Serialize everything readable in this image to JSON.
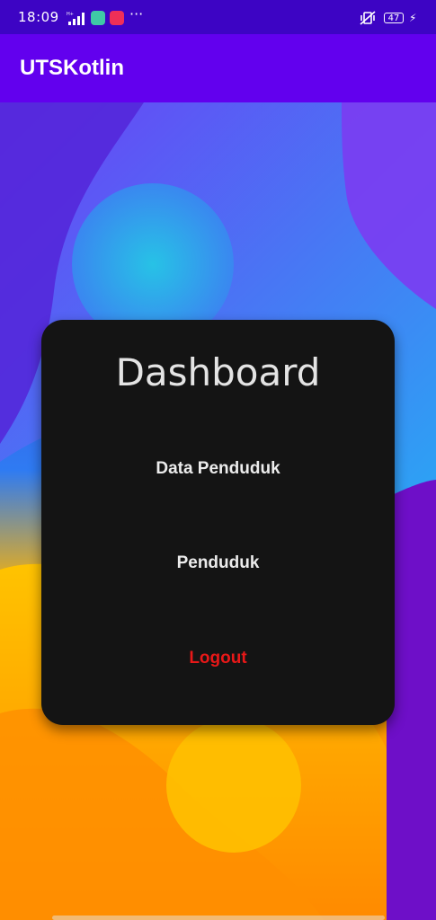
{
  "status_bar": {
    "time": "18:09",
    "battery": "47",
    "more": "···",
    "icons": [
      "signal-icon",
      "app-notification-icon",
      "video-record-icon",
      "vibrate-icon",
      "battery-icon",
      "charging-icon"
    ]
  },
  "app_bar": {
    "title": "UTSKotlin"
  },
  "dashboard": {
    "title": "Dashboard",
    "buttons": {
      "data_penduduk": "Data Penduduk",
      "penduduk": "Penduduk",
      "logout": "Logout"
    }
  },
  "colors": {
    "status_bar": "#3d04c4",
    "app_bar": "#6200ee",
    "card_bg": "#141414",
    "logout_text": "#e81818"
  }
}
